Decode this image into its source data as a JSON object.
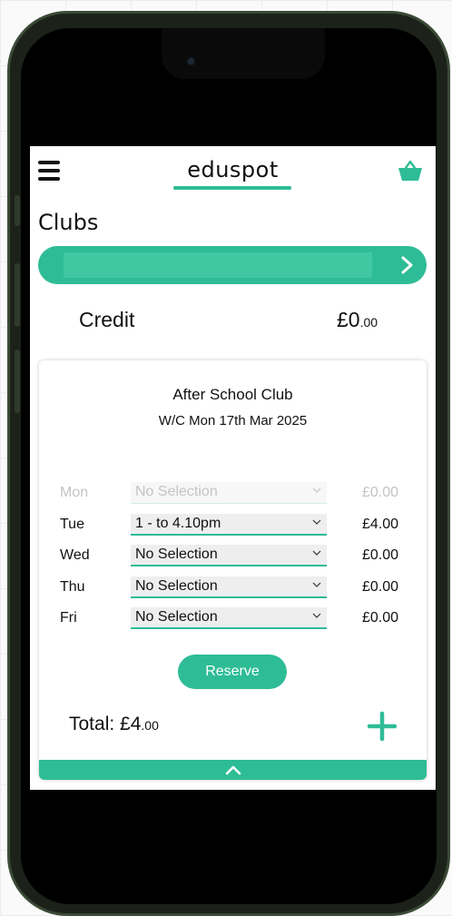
{
  "header": {
    "logo_text": "eduspot",
    "menu_icon": "hamburger-menu-icon",
    "basket_icon": "basket-icon"
  },
  "page": {
    "title": "Clubs"
  },
  "club_selector": {
    "icon": "chevron-right-icon"
  },
  "credit": {
    "label": "Credit",
    "value_main": "£0",
    "value_pence": ".00"
  },
  "booking": {
    "title": "After School Club",
    "week": "W/C Mon 17th Mar 2025",
    "days": [
      {
        "day": "Mon",
        "selection": "No Selection",
        "price": "£0.00",
        "disabled": true
      },
      {
        "day": "Tue",
        "selection": "1 - to 4.10pm",
        "price": "£4.00",
        "disabled": false
      },
      {
        "day": "Wed",
        "selection": "No Selection",
        "price": "£0.00",
        "disabled": false
      },
      {
        "day": "Thu",
        "selection": "No Selection",
        "price": "£0.00",
        "disabled": false
      },
      {
        "day": "Fri",
        "selection": "No Selection",
        "price": "£0.00",
        "disabled": false
      }
    ],
    "reserve_label": "Reserve",
    "total_label": "Total: ",
    "total_main": "£4",
    "total_pence": ".00",
    "add_icon": "plus-icon",
    "collapse_icon": "chevron-up-icon"
  },
  "colors": {
    "accent": "#2ebc96",
    "phone_frame": "#1c2219"
  }
}
